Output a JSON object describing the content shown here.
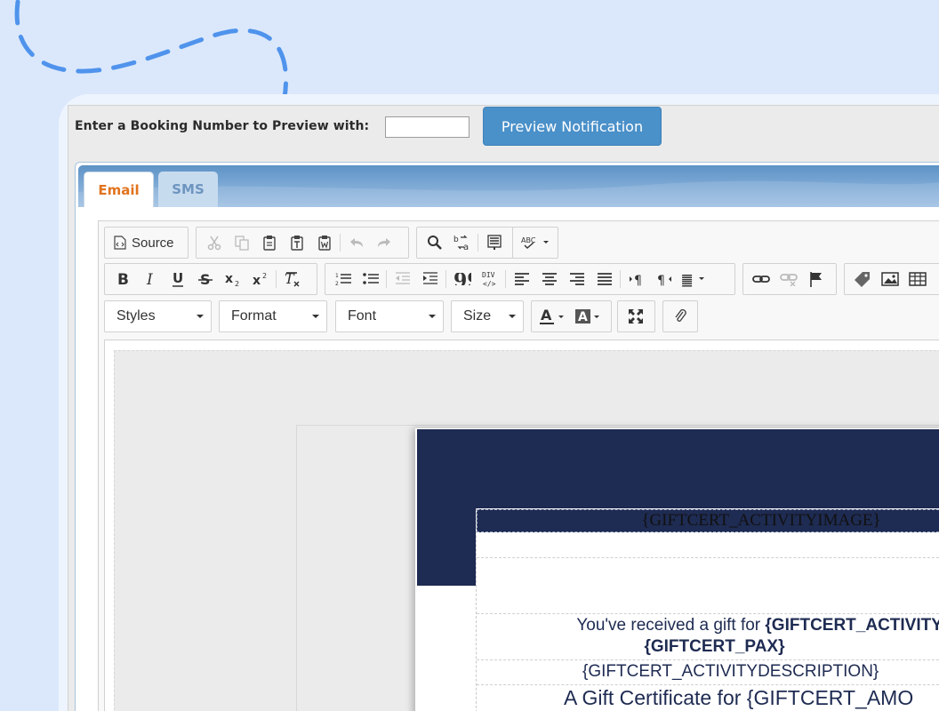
{
  "booking": {
    "label": "Enter a Booking Number to Preview with:",
    "input_value": "",
    "input_placeholder": "",
    "preview_button": "Preview Notification"
  },
  "tabs": [
    {
      "label": "Email",
      "active": true
    },
    {
      "label": "SMS",
      "active": false
    }
  ],
  "toolbar": {
    "source_label": "Source",
    "combos": {
      "styles": "Styles",
      "format": "Format",
      "font": "Font",
      "size": "Size"
    },
    "icons": {
      "row1": [
        "source-icon",
        "cut-icon",
        "copy-icon",
        "paste-icon",
        "paste-text-icon",
        "paste-word-icon",
        "undo-icon",
        "redo-icon",
        "find-icon",
        "replace-icon",
        "select-all-icon",
        "spellcheck-icon"
      ],
      "row2": [
        "bold-icon",
        "italic-icon",
        "underline-icon",
        "strike-icon",
        "subscript-icon",
        "superscript-icon",
        "remove-format-icon",
        "numbered-list-icon",
        "bulleted-list-icon",
        "outdent-icon",
        "indent-icon",
        "blockquote-icon",
        "div-icon",
        "align-left-icon",
        "align-center-icon",
        "align-right-icon",
        "justify-icon",
        "ltr-icon",
        "rtl-icon",
        "language-icon",
        "link-icon",
        "unlink-icon",
        "anchor-icon",
        "tag-icon",
        "image-icon",
        "table-icon"
      ],
      "row3": [
        "text-color-icon",
        "background-color-icon",
        "maximize-icon",
        "attachment-icon"
      ]
    }
  },
  "content": {
    "activity_image": "{GIFTCERT_ACTIVITYIMAGE}",
    "received_prefix": "You've received a gift for ",
    "activity_name": "{GIFTCERT_ACTIVITYN",
    "pax": "{GIFTCERT_PAX}",
    "description": "{GIFTCERT_ACTIVITYDESCRIPTION}",
    "amount_line": "A Gift Certificate for {GIFTCERT_AMO"
  },
  "colors": {
    "background": "#dbe8fb",
    "accent_blue": "#4a90c9",
    "tab_active_text": "#e1741f",
    "email_navy": "#1e2b52"
  }
}
